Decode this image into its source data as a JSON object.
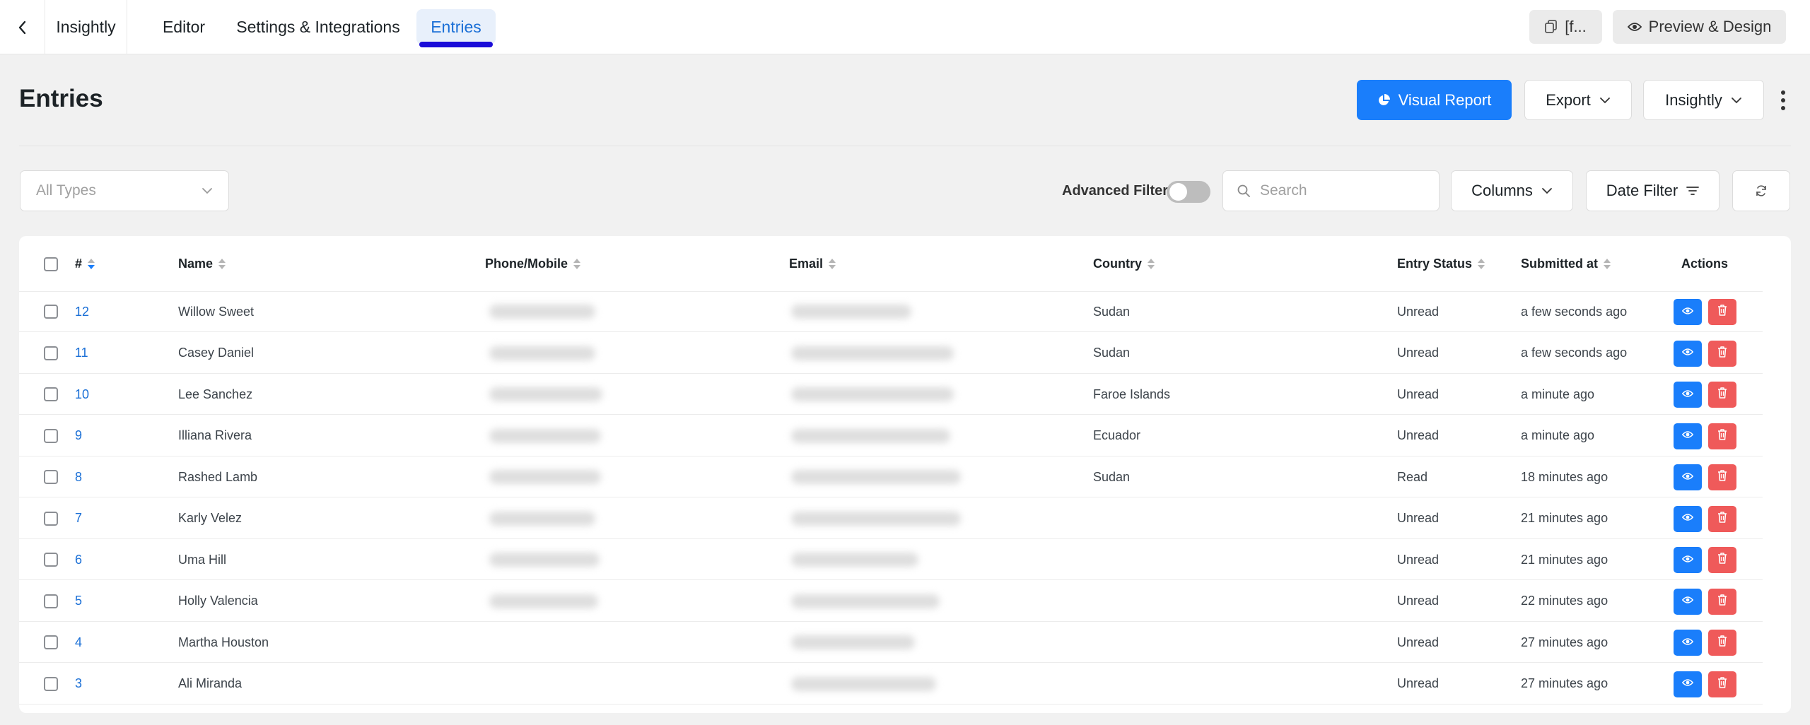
{
  "nav": {
    "brand": "Insightly",
    "tabs": [
      {
        "label": "Editor"
      },
      {
        "label": "Settings & Integrations"
      },
      {
        "label": "Entries"
      }
    ],
    "shortcode_label": "[f...",
    "preview_label": "Preview & Design"
  },
  "header": {
    "title": "Entries",
    "visual_report_label": "Visual Report",
    "export_label": "Export",
    "form_select_label": "Insightly"
  },
  "filters": {
    "type_placeholder": "All Types",
    "advanced_filter_label": "Advanced Filter",
    "advanced_filter_on": false,
    "search_placeholder": "Search",
    "columns_label": "Columns",
    "date_filter_label": "Date Filter"
  },
  "table": {
    "columns": [
      "#",
      "Name",
      "Phone/Mobile",
      "Email",
      "Country",
      "Entry Status",
      "Submitted at",
      "Actions"
    ],
    "rows": [
      {
        "id": "12",
        "name": "Willow Sweet",
        "country": "Sudan",
        "status": "Unread",
        "submitted": "a few seconds ago"
      },
      {
        "id": "11",
        "name": "Casey Daniel",
        "country": "Sudan",
        "status": "Unread",
        "submitted": "a few seconds ago"
      },
      {
        "id": "10",
        "name": "Lee Sanchez",
        "country": "Faroe Islands",
        "status": "Unread",
        "submitted": "a minute ago"
      },
      {
        "id": "9",
        "name": "Illiana Rivera",
        "country": "Ecuador",
        "status": "Unread",
        "submitted": "a minute ago"
      },
      {
        "id": "8",
        "name": "Rashed Lamb",
        "country": "Sudan",
        "status": "Read",
        "submitted": "18 minutes ago"
      },
      {
        "id": "7",
        "name": "Karly Velez",
        "country": "",
        "status": "Unread",
        "submitted": "21 minutes ago"
      },
      {
        "id": "6",
        "name": "Uma Hill",
        "country": "",
        "status": "Unread",
        "submitted": "21 minutes ago"
      },
      {
        "id": "5",
        "name": "Holly Valencia",
        "country": "",
        "status": "Unread",
        "submitted": "22 minutes ago"
      },
      {
        "id": "4",
        "name": "Martha Houston",
        "country": "",
        "status": "Unread",
        "submitted": "27 minutes ago"
      },
      {
        "id": "3",
        "name": "Ali Miranda",
        "country": "",
        "status": "Unread",
        "submitted": "27 minutes ago"
      }
    ]
  },
  "colors": {
    "accent": "#1a7efb",
    "active_tab_text": "#1a6fd6",
    "active_tab_underline": "#1a0cd8",
    "delete": "#ef5a5a"
  },
  "icons": {
    "back": "chevron-left-icon",
    "shortcode": "copy-icon",
    "preview": "eye-icon",
    "visual_report": "pie-chart-icon",
    "dropdown": "chevron-down-icon",
    "search": "search-icon",
    "date_filter": "filter-icon",
    "refresh": "refresh-icon",
    "view": "eye-icon",
    "delete": "trash-icon"
  }
}
